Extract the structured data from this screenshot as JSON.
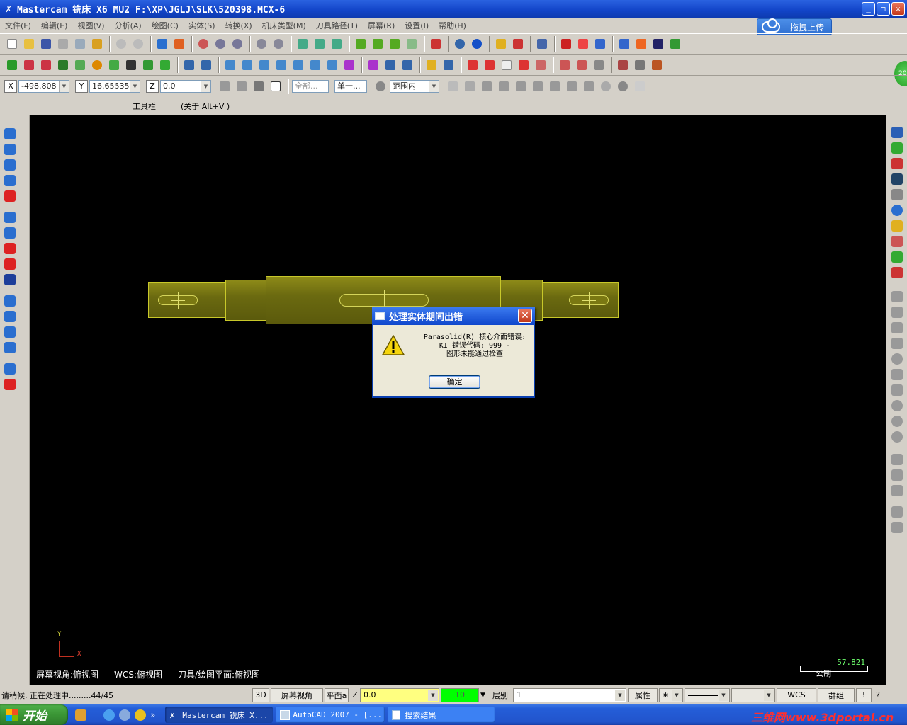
{
  "window": {
    "title": "Mastercam 铣床 X6 MU2  F:\\XP\\JGLJ\\SLK\\520398.MCX-6",
    "buttons": {
      "minimize": "_",
      "maximize": "❐",
      "close": "✕"
    }
  },
  "menu": [
    "文件(F)",
    "编辑(E)",
    "视图(V)",
    "分析(A)",
    "绘图(C)",
    "实体(S)",
    "转换(X)",
    "机床类型(M)",
    "刀具路径(T)",
    "屏幕(R)",
    "设置(I)",
    "帮助(H)"
  ],
  "upload_button": "拖拽上传",
  "badge": "20",
  "coords": {
    "x_label": "X",
    "x_value": "-498.808",
    "y_label": "Y",
    "y_value": "16.65535",
    "z_label": "Z",
    "z_value": "0.0",
    "select_all": "全部...",
    "select_single": "单一...",
    "range": "范围内"
  },
  "hint": {
    "toolbar": "工具栏",
    "about": "(关于 Alt+V )"
  },
  "viewport": {
    "axis_y": "Y",
    "axis_x": "X",
    "screen_view": "屏幕视角:俯视图",
    "wcs": "WCS:俯视图",
    "tool_plane": "刀具/绘图平面:俯视图",
    "scale_value": "57.821",
    "scale_unit": "公制"
  },
  "dialog": {
    "title": "处理实体期间出错",
    "line1": "Parasolid(R) 核心介面错误:",
    "line2": "KI 错误代码: 999 -",
    "line3": "图形未能通过检查",
    "ok": "确定",
    "close": "✕"
  },
  "status": {
    "message": "请稍候. 正在处理中.........44/45",
    "btn_3d": "3D",
    "btn_screen_view": "屏幕视角",
    "btn_plane": "平面a",
    "z_label": "Z",
    "z_value": "0.0",
    "color_value": "10",
    "level_label": "层别",
    "level_value": "1",
    "attr": "属性",
    "point_style": "∗",
    "wcs": "WCS",
    "group": "群组",
    "help": "!",
    "question": "?"
  },
  "taskbar": {
    "start": "开始",
    "chevron": "»",
    "tasks": [
      "Mastercam 铣床 X...",
      "AutoCAD 2007 - [...",
      "搜索结果"
    ],
    "watermark": "三维网www.3dportal.cn"
  },
  "colors": {
    "accent": "#245ed8",
    "canvas": "#000000",
    "shaft": "#7a7812",
    "status_z": "#ffff80",
    "status_color": "#00ff00"
  }
}
